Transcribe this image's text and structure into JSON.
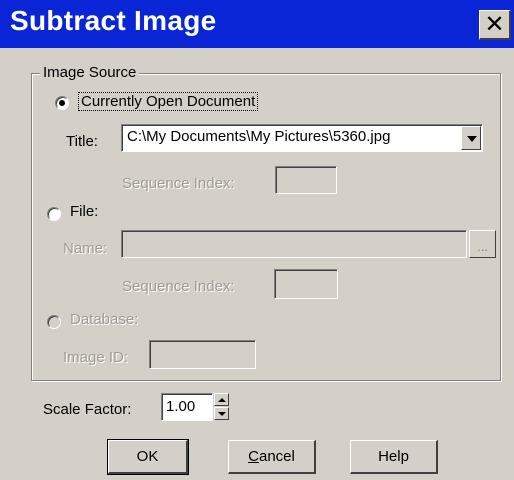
{
  "window": {
    "title": "Subtract Image",
    "close_glyph": "✕"
  },
  "image_source": {
    "group_label": "Image Source",
    "currently_open": {
      "label": "Currently Open Document",
      "selected": true
    },
    "title_label": "Title:",
    "title_value": "C:\\My Documents\\My Pictures\\5360.jpg",
    "sequence_index_label": "Sequence Index:",
    "sequence_index_value": "",
    "file": {
      "label": "File:",
      "selected": false
    },
    "name_label": "Name:",
    "name_value": "",
    "browse_label": "...",
    "file_sequence_index_label": "Sequence Index:",
    "file_sequence_index_value": "",
    "database": {
      "label": "Database:",
      "selected": false
    },
    "image_id_label": "Image ID:",
    "image_id_value": ""
  },
  "scale_factor": {
    "label": "Scale Factor:",
    "value": "1.00"
  },
  "buttons": {
    "ok": "OK",
    "cancel_underline": "C",
    "cancel_rest": "ancel",
    "help": "Help"
  },
  "icons": [
    "close-icon",
    "dropdown-arrow-icon",
    "spin-up-icon",
    "spin-down-icon",
    "radio-selected-icon"
  ]
}
